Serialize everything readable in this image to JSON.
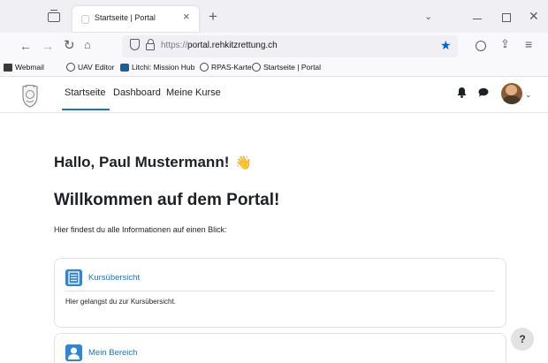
{
  "browser": {
    "tab": {
      "title": "Startseite | Portal",
      "close_glyph": "×"
    },
    "new_tab_glyph": "+",
    "overflow_glyph": "⌄",
    "window": {
      "close_glyph": "✕"
    },
    "nav": {
      "back_glyph": "←",
      "forward_glyph": "→",
      "reload_glyph": "↻",
      "home_glyph": "⌂",
      "share_glyph": "⇪",
      "menu_glyph": "≡"
    },
    "url": {
      "scheme": "https://",
      "domain": "portal.rehkitzrettung.ch",
      "star_glyph": "★",
      "star_color": "#0060df"
    },
    "bookmarks": [
      {
        "label": "Webmail",
        "icon": "mail-icon"
      },
      {
        "label": "UAV Editor",
        "icon": "globe-icon"
      },
      {
        "label": "Litchi: Mission Hub",
        "icon": "litchi-icon"
      },
      {
        "label": "RPAS-Karte",
        "icon": "globe-icon"
      },
      {
        "label": "Startseite | Portal",
        "icon": "globe-icon"
      }
    ]
  },
  "site": {
    "nav": [
      {
        "label": "Startseite",
        "active": true
      },
      {
        "label": "Dashboard",
        "active": false
      },
      {
        "label": "Meine Kurse",
        "active": false
      }
    ],
    "accent_color": "#1177d1",
    "avatar_chevron": "⌄"
  },
  "main": {
    "greeting": "Hallo, Paul Mustermann!",
    "wave_emoji": "👋",
    "welcome": "Willkommen auf dem Portal!",
    "intro": "Hier findest du alle Informationen auf einen Blick:",
    "cards": [
      {
        "title": "Kursübersicht",
        "description": "Hier gelangst du zur Kursübersicht.",
        "icon": "course-list-icon"
      },
      {
        "title": "Mein Bereich",
        "icon": "user-icon"
      }
    ]
  },
  "help": {
    "label": "?"
  }
}
